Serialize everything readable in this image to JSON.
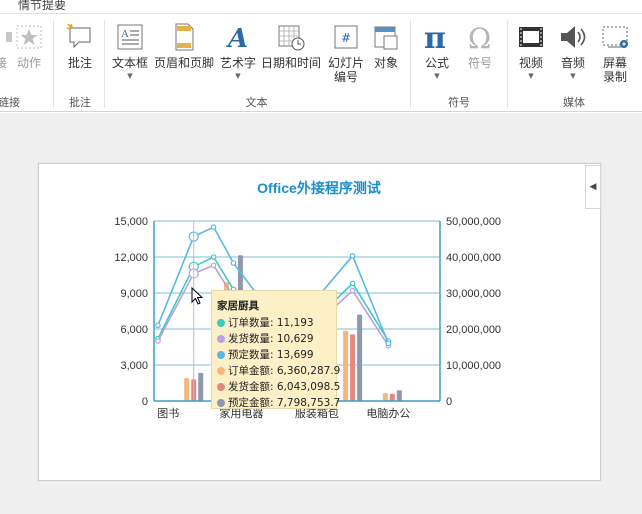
{
  "ribbon": {
    "tab_label": "情节提要",
    "groups": {
      "links": "链接",
      "comments": "批注",
      "text": "文本",
      "symbols": "符号",
      "media": "媒体"
    },
    "buttons": {
      "link": "接",
      "action": "动作",
      "comment": "批注",
      "textbox": "文本框",
      "header_footer": "页眉和页脚",
      "wordart": "艺术字",
      "datetime": "日期和时间",
      "slide_number_line1": "幻灯片",
      "slide_number_line2": "编号",
      "object": "对象",
      "equation": "公式",
      "symbol": "符号",
      "video": "视频",
      "audio": "音频",
      "screen_recording_line1": "屏幕",
      "screen_recording_line2": "录制"
    }
  },
  "chart_data": {
    "type": "bar",
    "title": "Office外接程序测试",
    "categories": [
      "图书",
      "家用电器",
      "服装箱包",
      "电脑办公"
    ],
    "ylim": [
      0,
      15000
    ],
    "y_ticks": [
      "0",
      "3,000",
      "6,000",
      "9,000",
      "12,000",
      "15,000"
    ],
    "y2lim": [
      0,
      50000000
    ],
    "y2_ticks": [
      "0",
      "10,000,000",
      "20,000,000",
      "30,000,000",
      "40,000,000",
      "50,000,000"
    ],
    "x_positions": [
      0,
      1,
      1.5,
      2,
      2.5,
      3,
      3.5
    ],
    "line_series": [
      {
        "name": "订单数量",
        "color": "#3ec9c2",
        "values": [
          5200,
          11193,
          12000,
          9300,
          5700,
          6300,
          9800,
          5000
        ]
      },
      {
        "name": "发货数量",
        "color": "#b9a2db",
        "values": [
          5000,
          10629,
          11300,
          8700,
          5400,
          5900,
          9200,
          4600
        ]
      },
      {
        "name": "预定数量",
        "color": "#5ab8e6",
        "values": [
          6300,
          13699,
          14500,
          11500,
          7100,
          7800,
          12100,
          4800
        ]
      }
    ],
    "line_x": [
      0.05,
      0.5,
      0.75,
      1.0,
      1.5,
      1.95,
      2.5,
      2.95
    ],
    "bar_series": [
      {
        "name": "订单金额",
        "color": "#f5b77b",
        "values": [
          0,
          6360287.9,
          33000000,
          1200000,
          19500000,
          2200000
        ]
      },
      {
        "name": "发货金额",
        "color": "#e38880",
        "values": [
          0,
          6043098.5,
          31000000,
          1100000,
          18500000,
          2000000
        ]
      },
      {
        "name": "预定金额",
        "color": "#8e98af",
        "values": [
          0,
          7798753.7,
          40500000,
          1500000,
          24000000,
          3000000
        ]
      }
    ],
    "bar_x": [
      0.0,
      0.5,
      1.0,
      1.5,
      2.5,
      3.0
    ],
    "tooltip": {
      "category": "家居厨具",
      "rows": [
        {
          "name": "订单数量",
          "value": "11,193",
          "color": "#3ec9c2"
        },
        {
          "name": "发货数量",
          "value": "10,629",
          "color": "#b9a2db"
        },
        {
          "name": "预定数量",
          "value": "13,699",
          "color": "#5ab8e6"
        },
        {
          "name": "订单金额",
          "value": "6,360,287.9",
          "color": "#f5b77b"
        },
        {
          "name": "发货金额",
          "value": "6,043,098.5",
          "color": "#e38880"
        },
        {
          "name": "预定金额",
          "value": "7,798,753.7",
          "color": "#8e98af"
        }
      ]
    },
    "grid": true,
    "legend": "none"
  },
  "colors": {
    "axis": "#3aa0c7",
    "grid": "#55aac9",
    "title": "#1a8fcf",
    "accent_blue": "#2b6aa3"
  }
}
